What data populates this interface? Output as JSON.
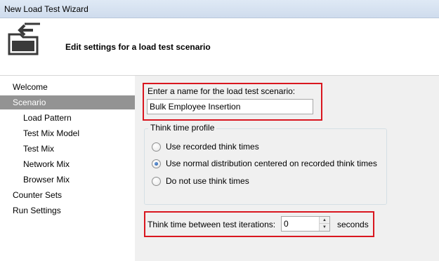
{
  "window": {
    "title": "New Load Test Wizard"
  },
  "header": {
    "heading": "Edit settings for a load test scenario",
    "icon": "wizard-icon"
  },
  "nav": {
    "items": [
      {
        "label": "Welcome",
        "level": 0,
        "selected": false
      },
      {
        "label": "Scenario",
        "level": 0,
        "selected": true
      },
      {
        "label": "Load Pattern",
        "level": 1,
        "selected": false
      },
      {
        "label": "Test Mix Model",
        "level": 1,
        "selected": false
      },
      {
        "label": "Test Mix",
        "level": 1,
        "selected": false
      },
      {
        "label": "Network Mix",
        "level": 1,
        "selected": false
      },
      {
        "label": "Browser Mix",
        "level": 1,
        "selected": false
      },
      {
        "label": "Counter Sets",
        "level": 0,
        "selected": false
      },
      {
        "label": "Run Settings",
        "level": 0,
        "selected": false
      }
    ]
  },
  "scenario": {
    "name_label": "Enter a name for the load test scenario:",
    "name_value": "Bulk Employee Insertion"
  },
  "think_profile": {
    "legend": "Think time profile",
    "options": [
      {
        "label": "Use recorded think times",
        "checked": false
      },
      {
        "label": "Use normal distribution centered on recorded think times",
        "checked": true
      },
      {
        "label": "Do not use think times",
        "checked": false
      }
    ]
  },
  "iterations": {
    "label": "Think time between test iterations:",
    "value": "0",
    "unit": "seconds"
  },
  "colors": {
    "highlight_box": "#d9161f",
    "selected_nav": "#939393",
    "content_bg": "#f0f0f0"
  }
}
